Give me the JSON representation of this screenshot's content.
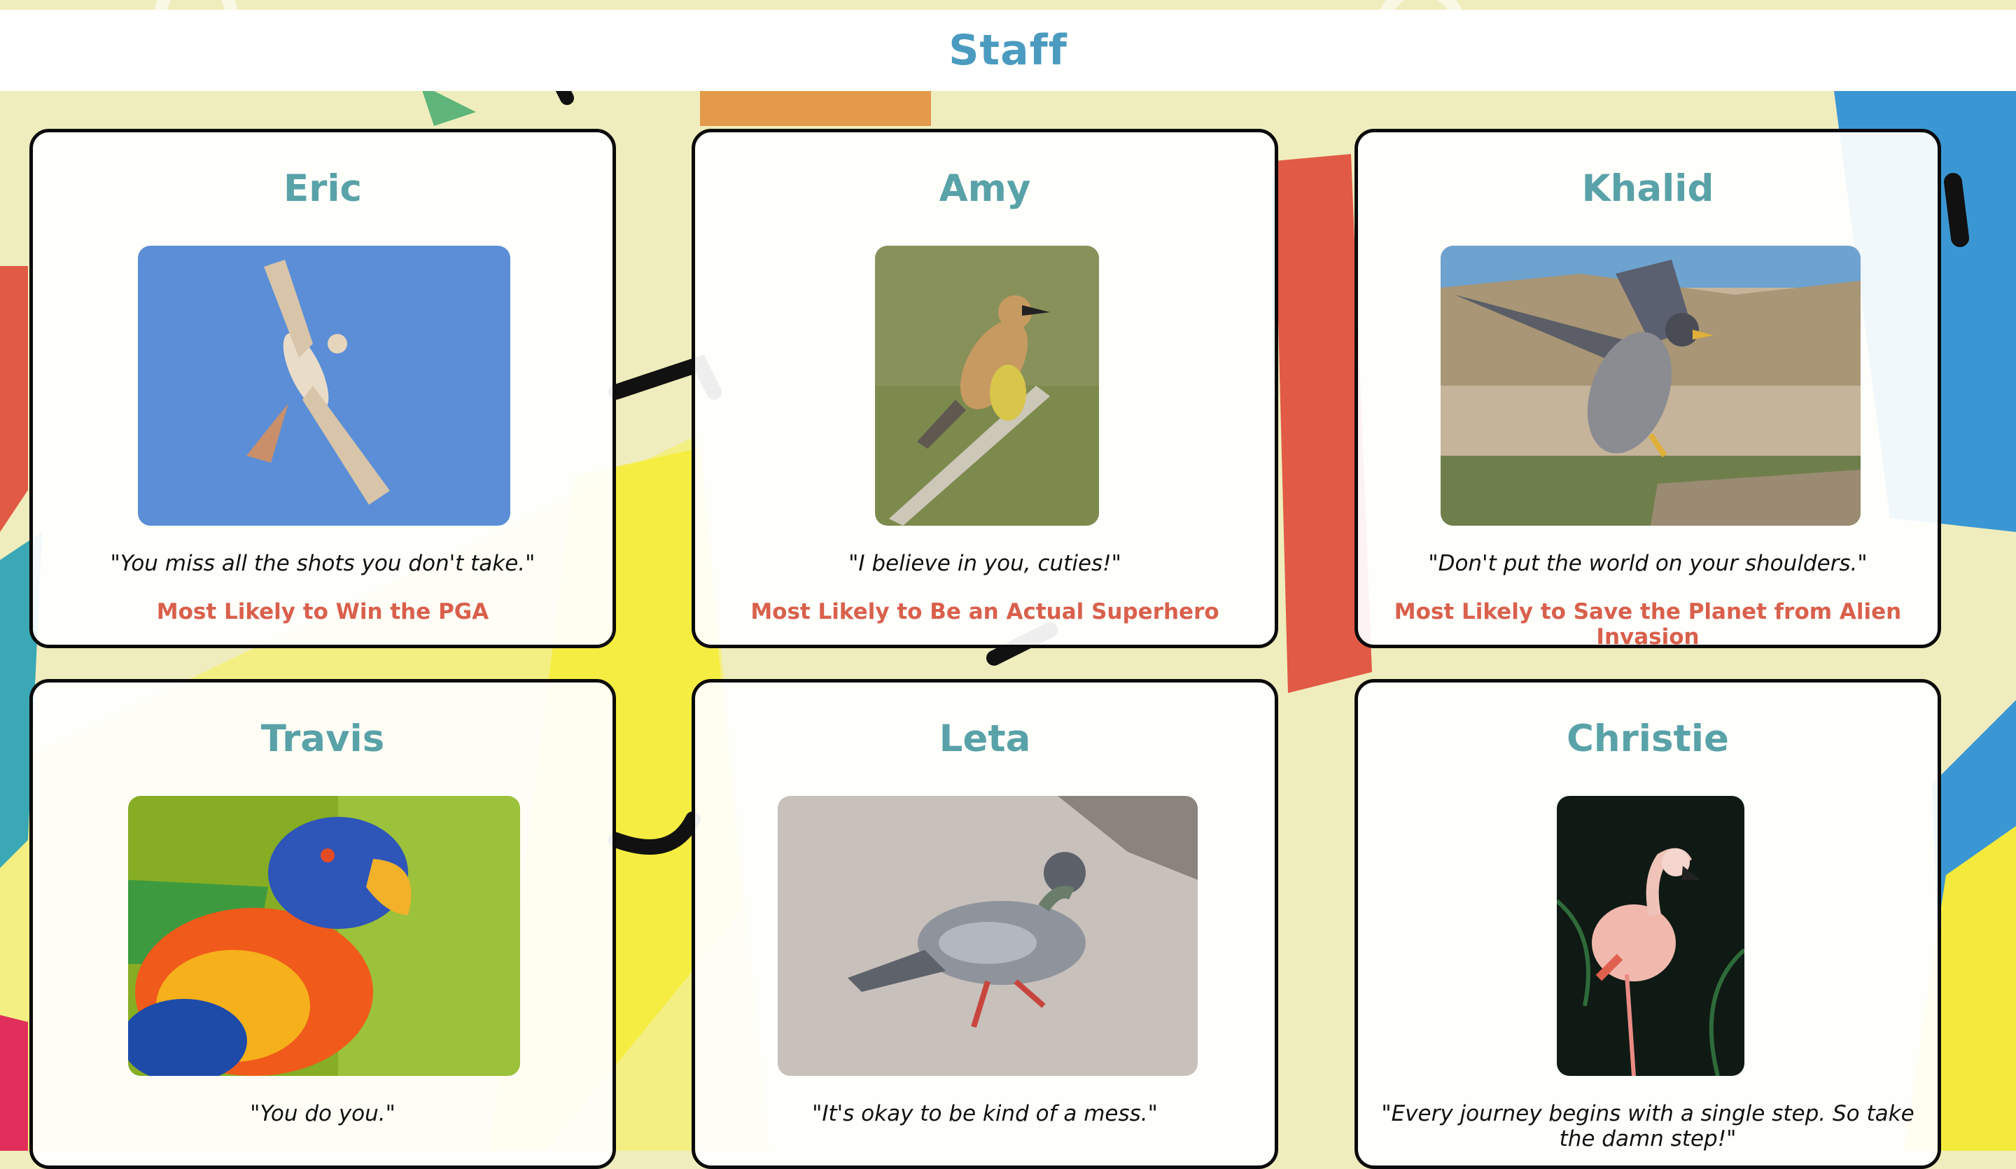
{
  "page": {
    "title": "Staff"
  },
  "colors": {
    "title": "#4a9bbf",
    "name": "#58a2a8",
    "award": "#d9604c",
    "card_border": "#0b0b0b",
    "background": "#efedbd"
  },
  "staff": [
    {
      "name": "Eric",
      "quote": "\"You miss all the shots you don't take.\"",
      "award": "Most Likely to Win the PGA",
      "photo_icon": "hawk-photo"
    },
    {
      "name": "Amy",
      "quote": "\"I believe in you, cuties!\"",
      "award": "Most Likely to Be an Actual Superhero",
      "photo_icon": "cedar-waxwing-photo"
    },
    {
      "name": "Khalid",
      "quote": "\"Don't put the world on your shoulders.\"",
      "award": "Most Likely to Save the Planet from Alien Invasion",
      "photo_icon": "falcon-photo"
    },
    {
      "name": "Travis",
      "quote": "\"You do you.\"",
      "award": "",
      "photo_icon": "lorikeet-photo"
    },
    {
      "name": "Leta",
      "quote": "\"It's okay to be kind of a mess.\"",
      "award": "",
      "photo_icon": "pigeon-photo"
    },
    {
      "name": "Christie",
      "quote": "\"Every journey begins with a single step. So take the damn step!\"",
      "award": "",
      "photo_icon": "flamingo-photo"
    }
  ]
}
